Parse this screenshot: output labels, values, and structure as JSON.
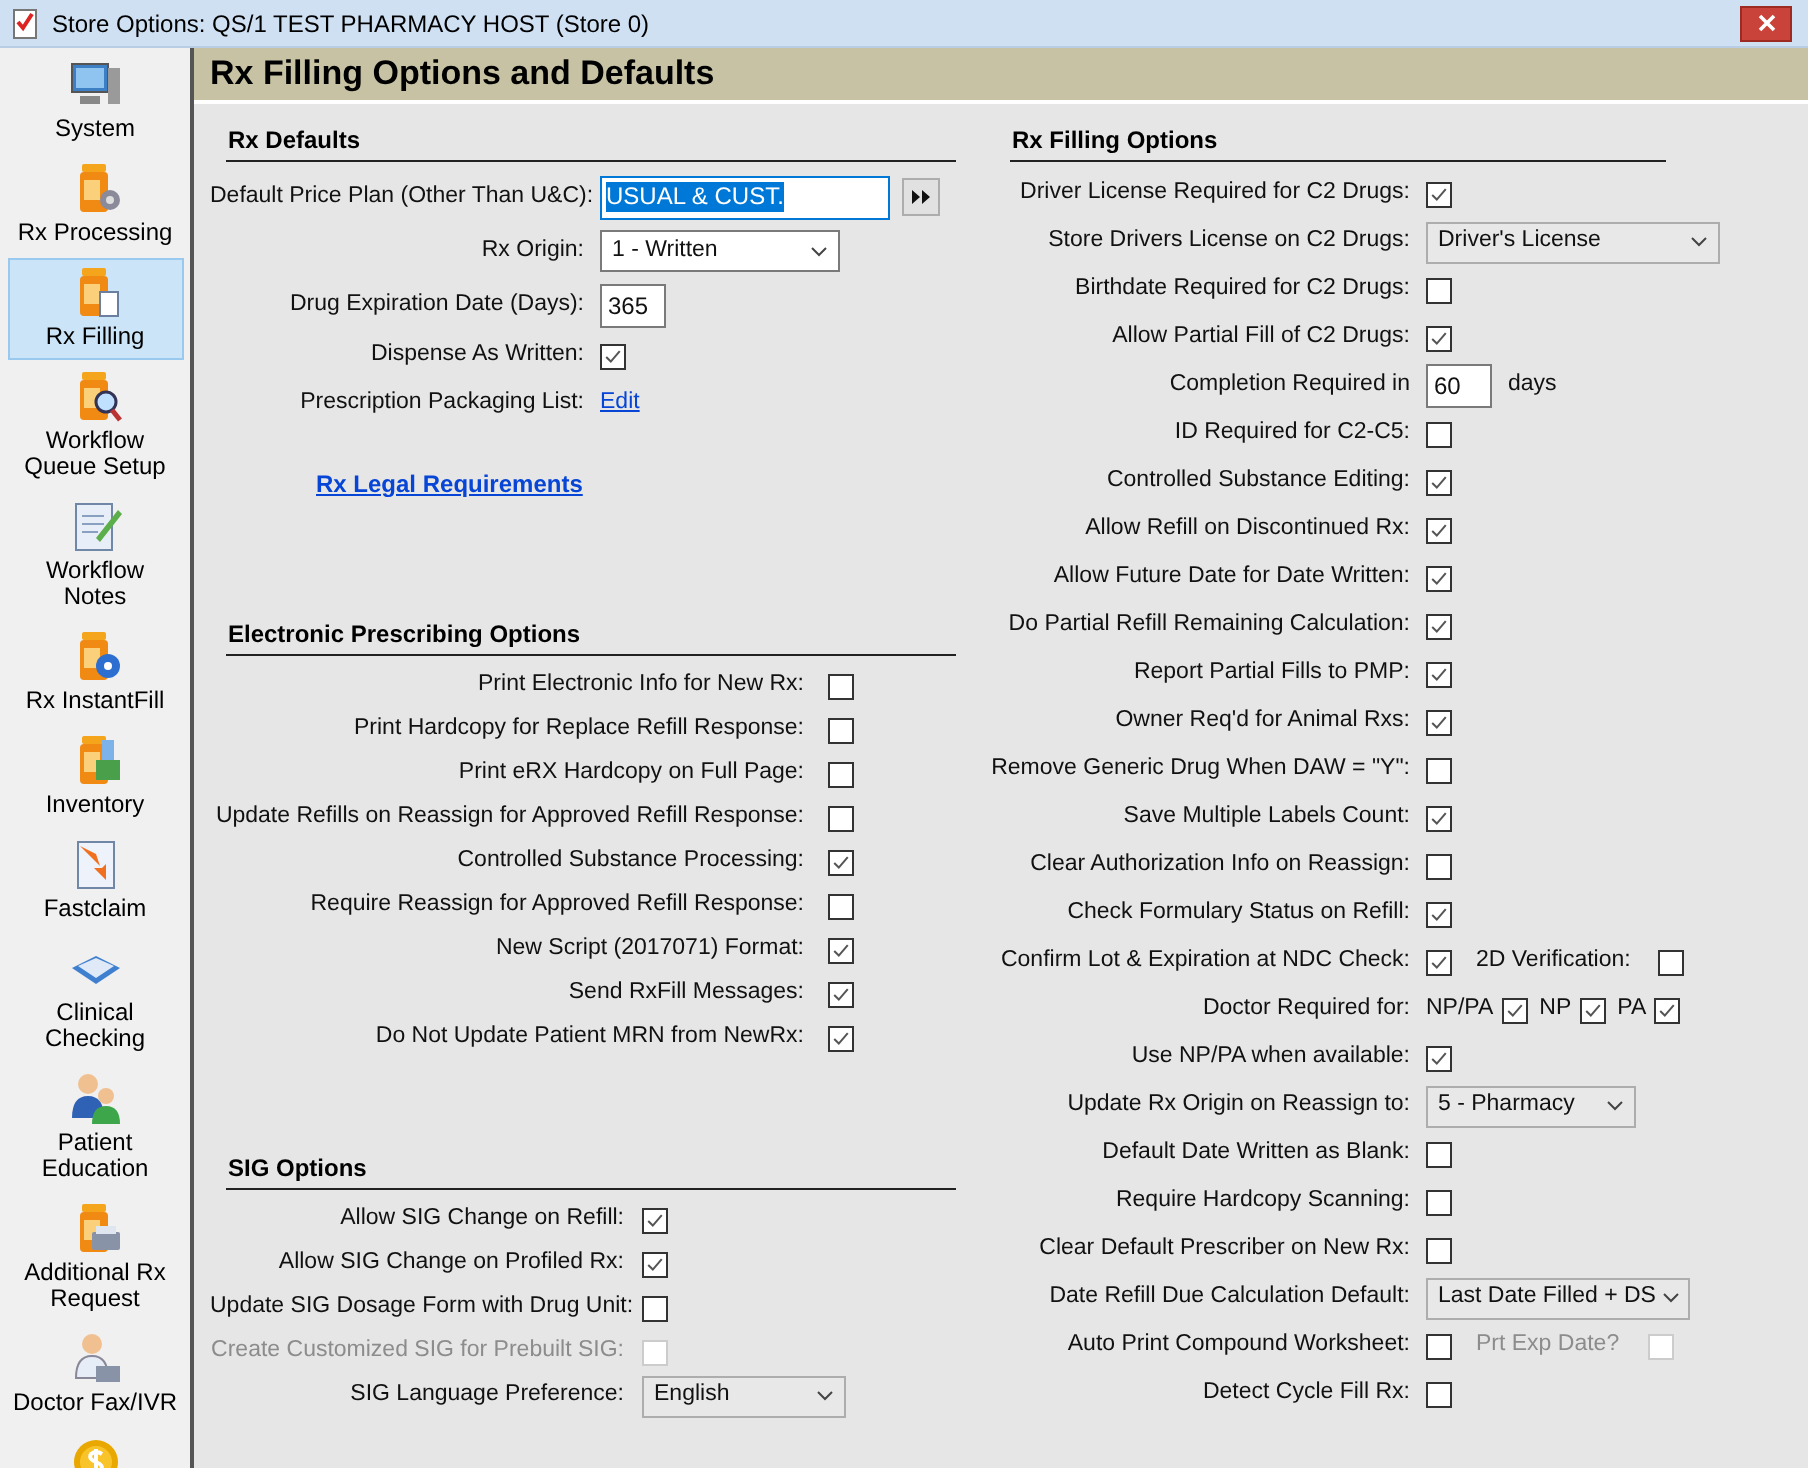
{
  "window": {
    "title": "Store Options: QS/1 TEST PHARMACY HOST (Store 0)"
  },
  "sidebar": {
    "items": [
      {
        "label": "System",
        "selected": false
      },
      {
        "label": "Rx Processing",
        "selected": false
      },
      {
        "label": "Rx Filling",
        "selected": true
      },
      {
        "label": "Workflow\nQueue Setup",
        "selected": false
      },
      {
        "label": "Workflow\nNotes",
        "selected": false
      },
      {
        "label": "Rx InstantFill",
        "selected": false
      },
      {
        "label": "Inventory",
        "selected": false
      },
      {
        "label": "Fastclaim",
        "selected": false
      },
      {
        "label": "Clinical\nChecking",
        "selected": false
      },
      {
        "label": "Patient\nEducation",
        "selected": false
      },
      {
        "label": "Additional Rx\nRequest",
        "selected": false
      },
      {
        "label": "Doctor Fax/IVR",
        "selected": false
      }
    ]
  },
  "header": {
    "title": "Rx Filling Options and Defaults"
  },
  "left_sections": [
    {
      "title": "Rx Defaults",
      "rows": [
        {
          "kind": "field",
          "label": "Default Price Plan (Other Than U&C):",
          "value": "USUAL & CUST.",
          "text_selected": true
        },
        {
          "kind": "select",
          "label": "Rx Origin:",
          "value": "1 - Written"
        },
        {
          "kind": "number",
          "label": "Drug Expiration Date (Days):",
          "value": "365"
        },
        {
          "kind": "checkbox",
          "label": "Dispense As Written:",
          "checked": true
        },
        {
          "kind": "link",
          "label": "Prescription Packaging List:",
          "link": "Edit"
        }
      ],
      "legal_link": "Rx Legal Requirements"
    },
    {
      "title": "Electronic Prescribing Options",
      "rows": [
        {
          "kind": "checkbox",
          "label": "Print Electronic Info for New Rx:",
          "checked": false
        },
        {
          "kind": "checkbox",
          "label": "Print Hardcopy for Replace Refill Response:",
          "checked": false
        },
        {
          "kind": "checkbox",
          "label": "Print eRX Hardcopy on Full Page:",
          "checked": false
        },
        {
          "kind": "checkbox",
          "label": "Update Refills on Reassign for Approved Refill Response:",
          "checked": false
        },
        {
          "kind": "checkbox",
          "label": "Controlled Substance Processing:",
          "checked": true
        },
        {
          "kind": "checkbox",
          "label": "Require Reassign for Approved Refill Response:",
          "checked": false
        },
        {
          "kind": "checkbox",
          "label": "New Script (2017071) Format:",
          "checked": true
        },
        {
          "kind": "checkbox",
          "label": "Send RxFill Messages:",
          "checked": true
        },
        {
          "kind": "checkbox",
          "label": "Do Not Update Patient MRN from NewRx:",
          "checked": true
        }
      ]
    },
    {
      "title": "SIG Options",
      "rows": [
        {
          "kind": "checkbox",
          "label": "Allow SIG Change on Refill:",
          "checked": true
        },
        {
          "kind": "checkbox",
          "label": "Allow SIG Change on Profiled Rx:",
          "checked": true
        },
        {
          "kind": "checkbox",
          "label": "Update SIG Dosage Form with Drug Unit:",
          "checked": false
        },
        {
          "kind": "checkbox",
          "label": "Create Customized SIG for Prebuilt SIG:",
          "checked": false,
          "disabled": true
        },
        {
          "kind": "select",
          "label": "SIG Language Preference:",
          "value": "English"
        }
      ]
    }
  ],
  "right_section": {
    "title": "Rx Filling Options",
    "rows": [
      {
        "kind": "checkbox",
        "label": "Driver License Required for C2 Drugs:",
        "checked": true
      },
      {
        "kind": "select",
        "label": "Store Drivers License on C2 Drugs:",
        "value": "Driver's License"
      },
      {
        "kind": "checkbox",
        "label": "Birthdate Required for C2 Drugs:",
        "checked": false
      },
      {
        "kind": "checkbox",
        "label": "Allow Partial Fill of C2 Drugs:",
        "checked": true
      },
      {
        "kind": "number",
        "label": "Completion Required in",
        "value": "60",
        "suffix": "days"
      },
      {
        "kind": "checkbox",
        "label": "ID Required for C2-C5:",
        "checked": false
      },
      {
        "kind": "checkbox",
        "label": "Controlled Substance Editing:",
        "checked": true
      },
      {
        "kind": "checkbox",
        "label": "Allow Refill on Discontinued Rx:",
        "checked": true
      },
      {
        "kind": "checkbox",
        "label": "Allow Future Date for Date Written:",
        "checked": true
      },
      {
        "kind": "checkbox",
        "label": "Do Partial Refill Remaining Calculation:",
        "checked": true
      },
      {
        "kind": "checkbox",
        "label": "Report Partial Fills to PMP:",
        "checked": true
      },
      {
        "kind": "checkbox",
        "label": "Owner Req'd for Animal Rxs:",
        "checked": true
      },
      {
        "kind": "checkbox",
        "label": "Remove Generic Drug When DAW = \"Y\":",
        "checked": false
      },
      {
        "kind": "checkbox",
        "label": "Save Multiple Labels Count:",
        "checked": true
      },
      {
        "kind": "checkbox",
        "label": "Clear Authorization Info on Reassign:",
        "checked": false
      },
      {
        "kind": "checkbox",
        "label": "Check Formulary Status on Refill:",
        "checked": true
      },
      {
        "kind": "checkbox",
        "label": "Confirm Lot & Expiration at NDC Check:",
        "checked": true,
        "extra": {
          "label": "2D Verification:",
          "checked": false,
          "disabled": false
        }
      },
      {
        "kind": "group",
        "label": "Doctor Required for:",
        "options": [
          {
            "label": "NP/PA",
            "checked": true
          },
          {
            "label": "NP",
            "checked": true
          },
          {
            "label": "PA",
            "checked": true
          }
        ]
      },
      {
        "kind": "checkbox",
        "label": "Use NP/PA when available:",
        "checked": true
      },
      {
        "kind": "select",
        "label": "Update Rx Origin on Reassign to:",
        "value": "5 - Pharmacy"
      },
      {
        "kind": "checkbox",
        "label": "Default Date Written as Blank:",
        "checked": false
      },
      {
        "kind": "checkbox",
        "label": "Require Hardcopy Scanning:",
        "checked": false
      },
      {
        "kind": "checkbox",
        "label": "Clear Default Prescriber on New Rx:",
        "checked": false
      },
      {
        "kind": "select",
        "label": "Date Refill Due Calculation Default:",
        "value": "Last Date Filled + DS"
      },
      {
        "kind": "checkbox",
        "label": "Auto Print Compound Worksheet:",
        "checked": false,
        "extra": {
          "label": "Prt Exp Date?",
          "checked": false,
          "disabled": true
        }
      },
      {
        "kind": "checkbox",
        "label": "Detect Cycle Fill Rx:",
        "checked": false
      }
    ]
  }
}
